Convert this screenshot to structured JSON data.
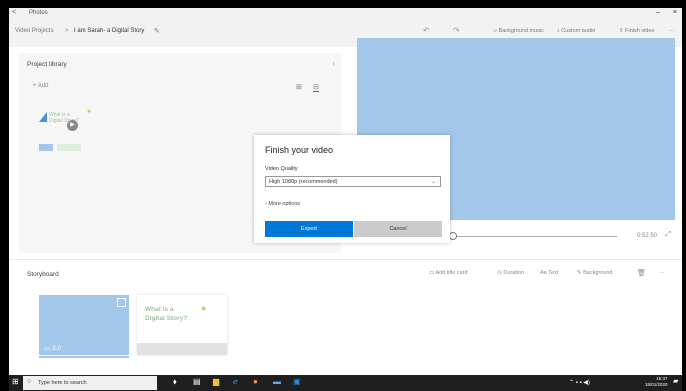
{
  "titlebar": {
    "back": "<",
    "title": "Photos",
    "minimize": "–",
    "close": "×"
  },
  "breadcrumb": {
    "root": "Video Projects",
    "sep": ">",
    "current": "I am Sarah- a Digital Story",
    "edit_icon": "✎"
  },
  "toolbar": {
    "undo": "↶",
    "redo": "↷",
    "music": "Background music",
    "audio": "Custom audio",
    "finish": "Finish video",
    "more": "···"
  },
  "library": {
    "title": "Project library",
    "add": "+ Add",
    "collapse": "‹",
    "thumb_title": "What is a Digital Story?"
  },
  "player": {
    "timecode": "0:52.50",
    "expand": "⤢"
  },
  "dialog": {
    "heading": "Finish your video",
    "quality_label": "Video Quality",
    "quality_value": "High 1080p (recommended)",
    "more_options": "More options",
    "export": "Export",
    "cancel": "Cancel"
  },
  "storyboard": {
    "title": "Storyboard",
    "title_card": "Add title card",
    "duration": "Duration",
    "text": "Text",
    "background": "Background",
    "card1_duration": "3.0",
    "card2_title": "What is a Digital Story?"
  },
  "taskbar": {
    "search_placeholder": "Type here to search",
    "time": "15:37",
    "date": "15/01/2020"
  },
  "colors": {
    "accent": "#0078d7",
    "preview": "#a3c7ea"
  }
}
